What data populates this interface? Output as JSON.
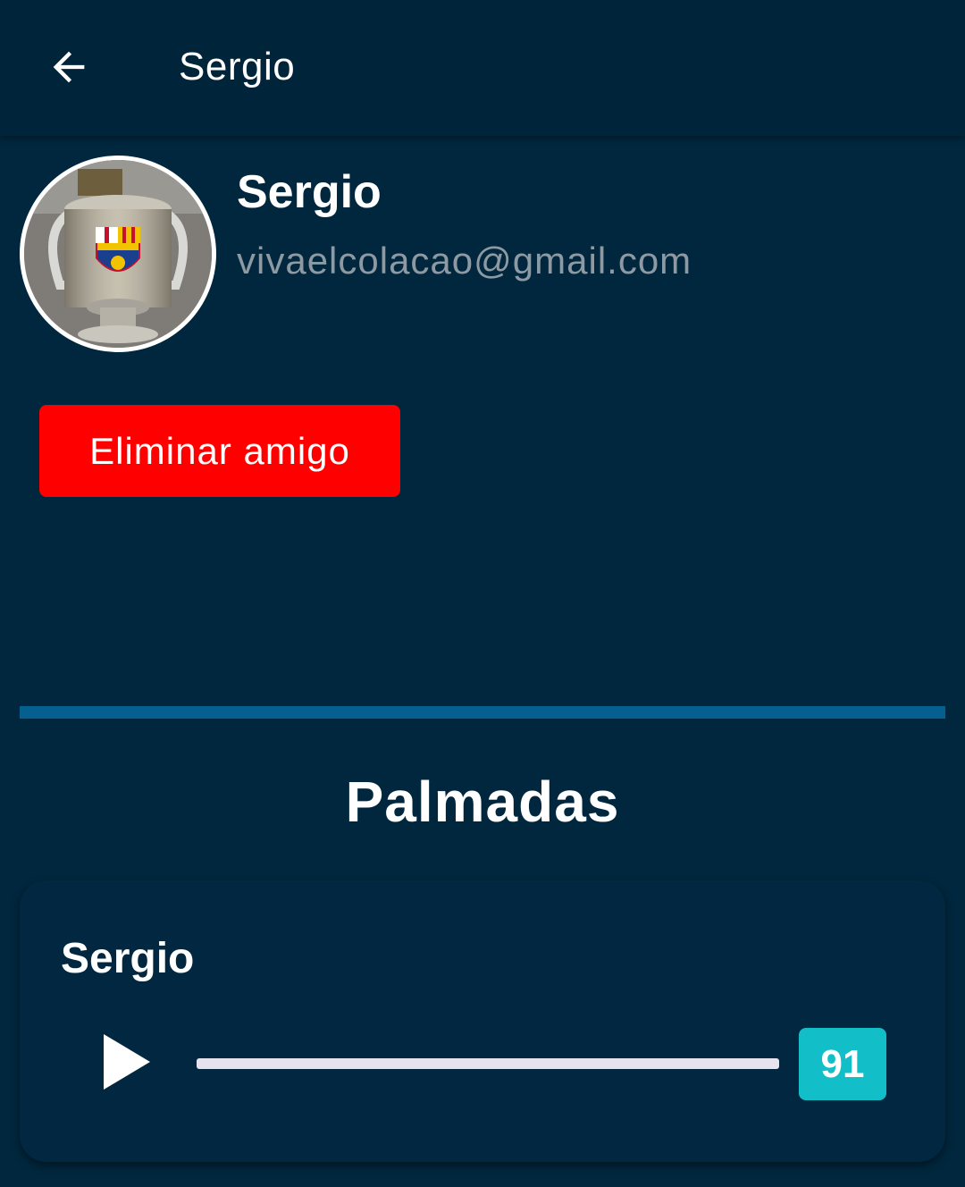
{
  "appbar": {
    "title": "Sergio",
    "back_icon": "arrow-left-icon"
  },
  "profile": {
    "name": "Sergio",
    "email": "vivaelcolacao@gmail.com",
    "avatar_icon": "avatar-photo"
  },
  "actions": {
    "remove_friend_label": "Eliminar amigo"
  },
  "section": {
    "title": "Palmadas"
  },
  "audio_card": {
    "title": "Sergio",
    "play_icon": "play-icon",
    "count": "91"
  },
  "colors": {
    "background": "#01273e",
    "appbar": "#00253b",
    "danger": "#ff0000",
    "divider": "#05608f",
    "badge": "#12bfc9",
    "email_text": "#8d9aa3"
  }
}
